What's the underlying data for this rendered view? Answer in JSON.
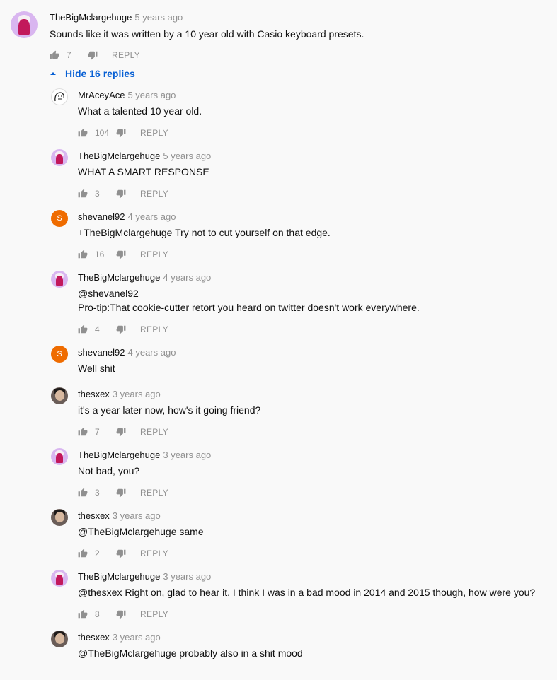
{
  "colors": {
    "background": "#f9f9f9",
    "link_blue": "#065fd4",
    "meta_gray": "#909090"
  },
  "action_labels": {
    "reply": "REPLY"
  },
  "top_comment": {
    "author": "TheBigMclargehuge",
    "time": "5 years ago",
    "text": "Sounds like it was written by a 10 year old with Casio keyboard presets.",
    "likes": "7",
    "avatar": "pink-avatar"
  },
  "hide_replies_label": "Hide 16 replies",
  "replies": [
    {
      "author": "MrAceyAce",
      "time": "5 years ago",
      "lines": [
        "What a talented 10 year old."
      ],
      "likes": "104",
      "avatar": "face-sketch"
    },
    {
      "author": "TheBigMclargehuge",
      "time": "5 years ago",
      "lines": [
        "WHAT A SMART RESPONSE"
      ],
      "likes": "3",
      "avatar": "pink-avatar"
    },
    {
      "author": "shevanel92",
      "time": "4 years ago",
      "lines": [
        "+TheBigMclargehuge Try not to cut yourself on that edge."
      ],
      "likes": "16",
      "avatar": "letter-s",
      "avatar_letter": "S"
    },
    {
      "author": "TheBigMclargehuge",
      "time": "4 years ago",
      "lines": [
        "@shevanel92",
        "Pro-tip:That cookie-cutter retort you heard on twitter doesn't work everywhere."
      ],
      "likes": "4",
      "avatar": "pink-avatar"
    },
    {
      "author": "shevanel92",
      "time": "4 years ago",
      "lines": [
        "Well shit"
      ],
      "likes": "",
      "avatar": "letter-s",
      "avatar_letter": "S"
    },
    {
      "author": "thesxex",
      "time": "3 years ago",
      "lines": [
        "it's a year later now, how's it going friend?"
      ],
      "likes": "7",
      "avatar": "photo-avatar"
    },
    {
      "author": "TheBigMclargehuge",
      "time": "3 years ago",
      "lines": [
        "Not bad, you?"
      ],
      "likes": "3",
      "avatar": "pink-avatar"
    },
    {
      "author": "thesxex",
      "time": "3 years ago",
      "lines": [
        "@TheBigMclargehuge same"
      ],
      "likes": "2",
      "avatar": "photo-avatar"
    },
    {
      "author": "TheBigMclargehuge",
      "time": "3 years ago",
      "lines": [
        "@thesxex Right on, glad to hear it.  I think I was in a bad mood in 2014 and 2015 though, how were you?"
      ],
      "likes": "8",
      "avatar": "pink-avatar"
    },
    {
      "author": "thesxex",
      "time": "3 years ago",
      "lines": [
        "@TheBigMclargehuge probably also in a shit mood"
      ],
      "likes": "",
      "avatar": "photo-avatar"
    }
  ]
}
